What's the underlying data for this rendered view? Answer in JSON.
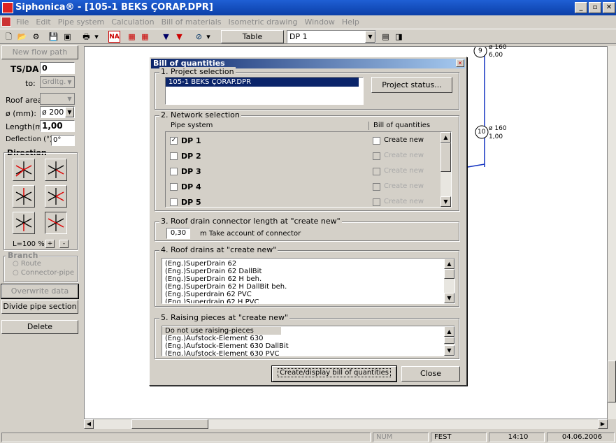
{
  "app": {
    "title": "Siphonica® - [105-1 BEKS ÇORAP.DPR]"
  },
  "menu": [
    "File",
    "Edit",
    "Pipe system",
    "Calculation",
    "Bill of materials",
    "Isometric drawing",
    "Window",
    "Help"
  ],
  "toolbar": {
    "table_label": "Table",
    "dp_select": "DP 1"
  },
  "left": {
    "new_flow_path": "New flow path",
    "tsda_label": "TS/DA",
    "tsda_value": "0",
    "to_label": "to:",
    "to_value": "Grdltg.",
    "roof_area_label": "Roof area:",
    "diam_label": "ø (mm):",
    "diam_value": "ø 200",
    "length_label": "Length(m):",
    "length_value": "1,00",
    "deflection_label": "Deflection (°):",
    "deflection_value": "0°",
    "direction_label": "Direction",
    "scale_label": "L=100 %",
    "plus": "+",
    "minus": "-",
    "branch_label": "Branch",
    "route_label": "Route",
    "connector_label": "Connector-pipe",
    "overwrite_label": "Overwrite data",
    "divide_label": "Divide pipe section",
    "delete_label": "Delete"
  },
  "canvas": {
    "node9": {
      "num": "9",
      "d": "ø 160",
      "v": "6,00"
    },
    "node10": {
      "num": "10",
      "d": "ø 160",
      "v": "1,00"
    }
  },
  "dialog": {
    "title": "Bill of quantities",
    "s1_label": "1. Project selection",
    "project": "105-1 BEKS ÇORAP.DPR",
    "project_status_btn": "Project status...",
    "s2_label": "2. Network selection",
    "col_pipe": "Pipe system",
    "col_bill": "Bill of quantities",
    "networks": [
      {
        "name": "DP 1",
        "checked": "✓",
        "create": "Create new"
      },
      {
        "name": "DP 2",
        "checked": "",
        "create": "Create new"
      },
      {
        "name": "DP 3",
        "checked": "",
        "create": "Create new"
      },
      {
        "name": "DP 4",
        "checked": "",
        "create": "Create new"
      },
      {
        "name": "DP 5",
        "checked": "",
        "create": "Create new"
      }
    ],
    "s3_label": "3. Roof drain connector length at \"create new\"",
    "connector_value": "0,30",
    "connector_text": "m Take account of connector",
    "s4_label": "4. Roof drains at \"create new\"",
    "drains": [
      "(Eng.)SuperDrain 62",
      "(Eng.)SuperDrain 62 DallBit",
      "(Eng.)SuperDrain 62 H beh.",
      "(Eng.)SuperDrain 62 H DallBit beh.",
      "(Eng.)Superdrain 62 PVC",
      "(Eng.)Superdrain 62 H PVC"
    ],
    "s5_label": "5. Raising pieces at \"create new\"",
    "raising": [
      "Do not use raising-pieces",
      "(Eng.)Aufstock-Element 630",
      "(Eng.)Aufstock-Element 630 DallBit",
      "(Eng.)Aufstock-Element 630 PVC"
    ],
    "create_btn": "Create/display bill of quantities",
    "close_btn": "Close"
  },
  "status": {
    "num": "NUM",
    "fest": "FEST",
    "time": "14:10",
    "date": "04.06.2006"
  }
}
